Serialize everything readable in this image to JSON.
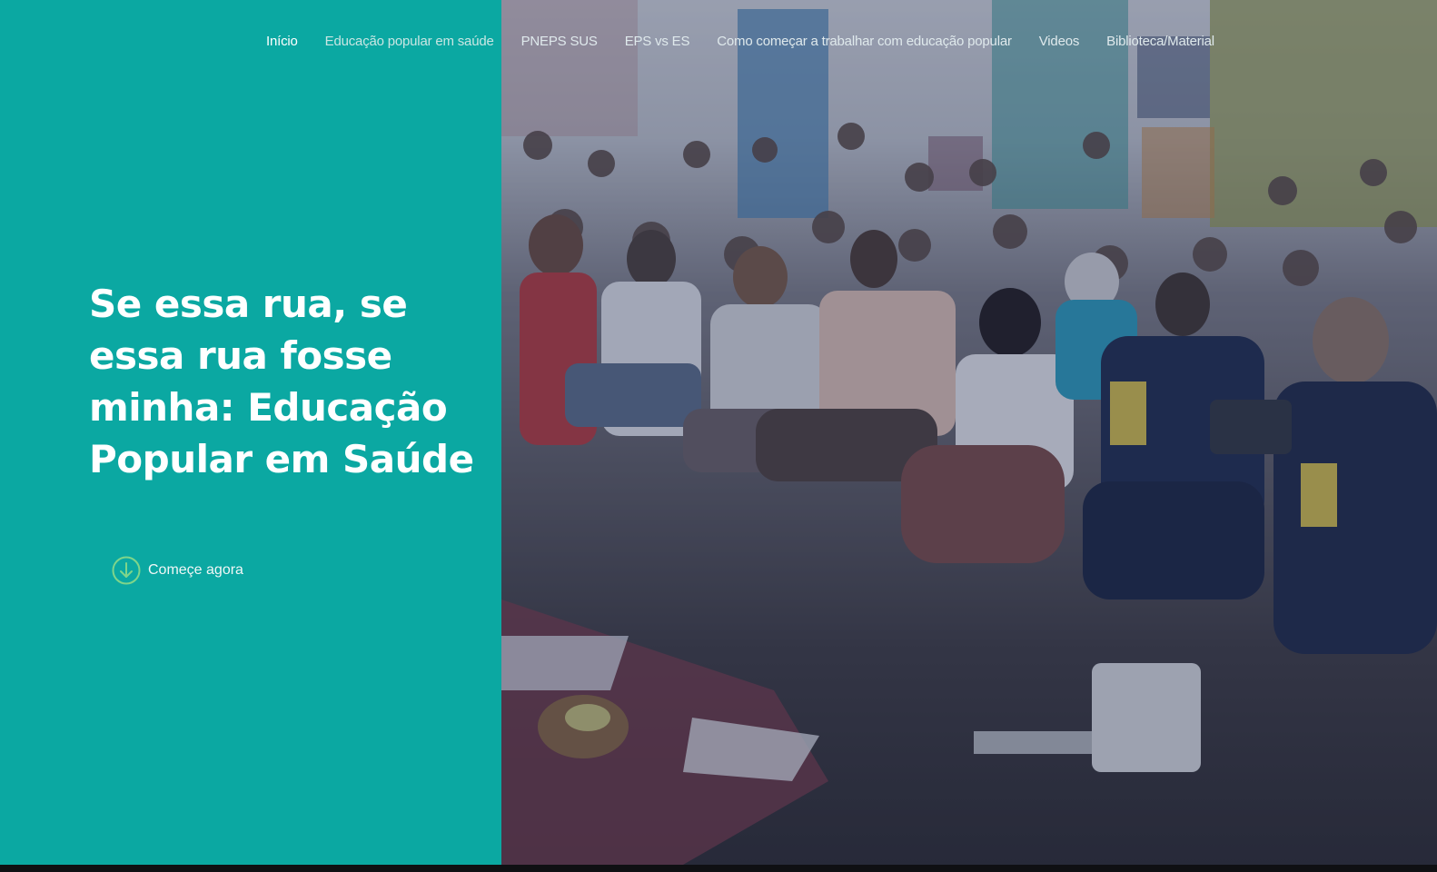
{
  "nav": {
    "items": [
      {
        "label": "Início",
        "active": true
      },
      {
        "label": "Educação popular em saúde",
        "active": false
      },
      {
        "label": "PNEPS SUS",
        "active": false
      },
      {
        "label": "EPS vs ES",
        "active": false
      },
      {
        "label": "Como começar a trabalhar com educação popular",
        "active": false
      },
      {
        "label": "Videos",
        "active": false
      },
      {
        "label": "Biblioteca/Material",
        "active": false
      }
    ]
  },
  "hero": {
    "headline": "Se essa rua, se essa rua fosse minha: Educação Popular em Saúde",
    "cta_label": "Começe agora",
    "cta_icon": "arrow-down-circle-icon"
  },
  "colors": {
    "teal_panel": "#0ba8a2",
    "cta_icon_green": "#7fd58a",
    "text_white": "#ffffff"
  }
}
